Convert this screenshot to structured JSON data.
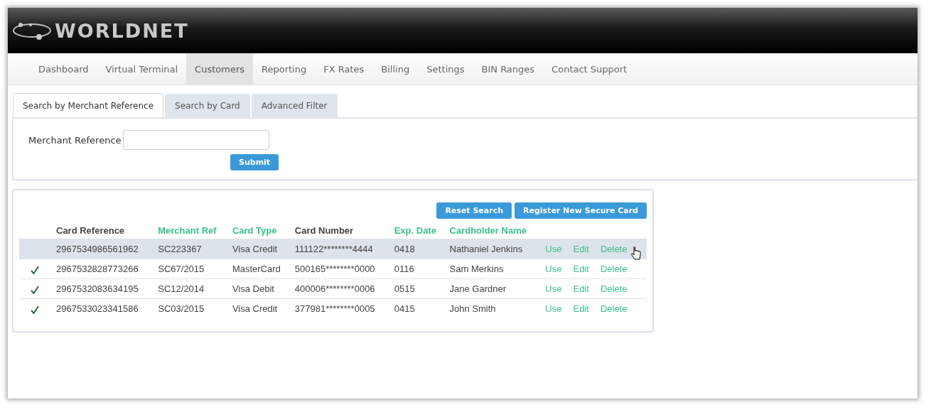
{
  "brand": {
    "name": "WORLDNET"
  },
  "nav": [
    {
      "label": "Dashboard",
      "selected": false
    },
    {
      "label": "Virtual Terminal",
      "selected": false
    },
    {
      "label": "Customers",
      "selected": true
    },
    {
      "label": "Reporting",
      "selected": false
    },
    {
      "label": "FX Rates",
      "selected": false
    },
    {
      "label": "Billing",
      "selected": false
    },
    {
      "label": "Settings",
      "selected": false
    },
    {
      "label": "BIN Ranges",
      "selected": false
    },
    {
      "label": "Contact Support",
      "selected": false
    }
  ],
  "tabs": [
    {
      "label": "Search by Merchant Reference",
      "selected": true
    },
    {
      "label": "Search by Card",
      "selected": false
    },
    {
      "label": "Advanced Filter",
      "selected": false
    }
  ],
  "search": {
    "label": "Merchant Reference",
    "submit": "Submit"
  },
  "actions": [
    "Reset Search",
    "Register New Secure Card"
  ],
  "table": {
    "columns": [
      {
        "label": "Card Reference",
        "sortable": false
      },
      {
        "label": "Merchant Ref",
        "sortable": true
      },
      {
        "label": "Card Type",
        "sortable": true
      },
      {
        "label": "Card Number",
        "sortable": false
      },
      {
        "label": "Exp. Date",
        "sortable": true
      },
      {
        "label": "Cardholder Name",
        "sortable": true
      }
    ],
    "rows": [
      {
        "checked": false,
        "selected": true,
        "cells": [
          "2967534986561962",
          "SC223367",
          "Visa Credit",
          "111122********4444",
          "0418",
          "Nathaniel Jenkins"
        ],
        "links": [
          "Use",
          "Edit",
          "Delete"
        ]
      },
      {
        "checked": true,
        "selected": false,
        "cells": [
          "2967532828773266",
          "SC67/2015",
          "MasterCard",
          "500165********0000",
          "0116",
          "Sam Merkins"
        ],
        "links": [
          "Use",
          "Edit",
          "Delete"
        ]
      },
      {
        "checked": true,
        "selected": false,
        "cells": [
          "2967532083634195",
          "SC12/2014",
          "Visa Debit",
          "400006********0006",
          "0515",
          "Jane Gardner"
        ],
        "links": [
          "Use",
          "Edit",
          "Delete"
        ]
      },
      {
        "checked": true,
        "selected": false,
        "cells": [
          "2967533023341586",
          "SC03/2015",
          "Visa Credit",
          "377981********0005",
          "0415",
          "John Smith"
        ],
        "links": [
          "Use",
          "Edit",
          "Delete"
        ]
      }
    ]
  }
}
